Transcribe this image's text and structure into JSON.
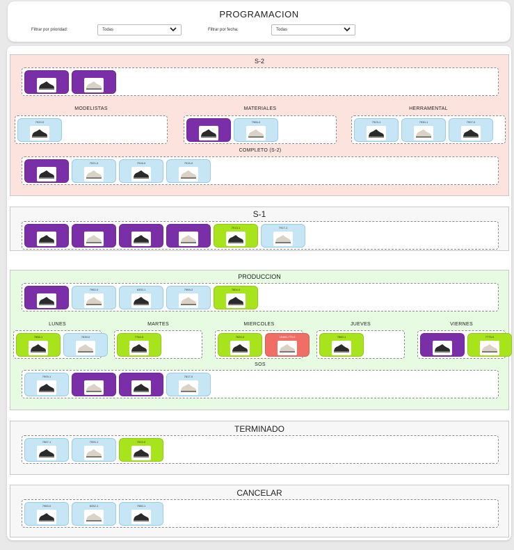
{
  "header": {
    "title": "PROGRAMACION",
    "priority_label": "Filtrar por prioridad:",
    "priority_value": "Todas",
    "date_label": "Filtrar por fecha:",
    "date_value": "Todas"
  },
  "icons": {
    "dropdown": "chevron-down-icon",
    "thumbnail": "shoe-thumbnail-icon"
  },
  "colors": {
    "purple": "#7a2fa8",
    "light_blue": "#c6e6f6",
    "lime": "#a8e41b",
    "red": "#f06e63",
    "s2_bg": "#fde3de",
    "produccion_bg": "#e6fbe2",
    "neutral_bg": "#f7f7f7"
  },
  "sections": {
    "s2": {
      "title": "S-2",
      "top_cards": [
        {
          "code": "",
          "color": "purple"
        },
        {
          "code": "",
          "color": "purple"
        }
      ],
      "modelistas": {
        "title": "MODELISTAS",
        "cards": [
          {
            "code": "7920-0",
            "color": "blue"
          }
        ]
      },
      "materiales": {
        "title": "MATERIALES",
        "cards": [
          {
            "code": "",
            "color": "purple"
          },
          {
            "code": "7966-0",
            "color": "blue"
          }
        ]
      },
      "herramental": {
        "title": "HERRAMENTAL",
        "cards": [
          {
            "code": "7923-1",
            "color": "blue"
          },
          {
            "code": "7930-1",
            "color": "blue"
          },
          {
            "code": "7907-0",
            "color": "blue"
          }
        ]
      },
      "completo": {
        "title": "COMPLETO (S-2)",
        "cards": [
          {
            "code": "",
            "color": "purple"
          },
          {
            "code": "7921-0",
            "color": "blue"
          },
          {
            "code": "7916-0",
            "color": "blue"
          },
          {
            "code": "7915-0",
            "color": "blue"
          }
        ]
      }
    },
    "s1": {
      "title": "S-1",
      "cards": [
        {
          "code": "",
          "color": "purple"
        },
        {
          "code": "",
          "color": "purple"
        },
        {
          "code": "",
          "color": "purple"
        },
        {
          "code": "",
          "color": "purple"
        },
        {
          "code": "7913-1",
          "color": "lime"
        },
        {
          "code": "7917-1",
          "color": "blue"
        }
      ]
    },
    "produccion": {
      "title": "PRODUCCION",
      "top_cards": [
        {
          "code": "",
          "color": "purple"
        },
        {
          "code": "7962-0",
          "color": "blue"
        },
        {
          "code": "6332-1",
          "color": "blue"
        },
        {
          "code": "7969-2",
          "color": "blue"
        },
        {
          "code": "7804-0",
          "color": "lime"
        }
      ],
      "lunes": {
        "title": "LUNES",
        "cards": [
          {
            "code": "7856-1",
            "color": "lime"
          },
          {
            "code": "7639-0",
            "color": "blue"
          }
        ]
      },
      "martes": {
        "title": "MARTES",
        "cards": [
          {
            "code": "7764-0",
            "color": "lime"
          }
        ]
      },
      "miercoles": {
        "title": "MIERCOLES",
        "cards": [
          {
            "code": "7620-0",
            "color": "lime"
          },
          {
            "code": "10460-773-0",
            "color": "red"
          }
        ]
      },
      "jueves": {
        "title": "JUEVES",
        "cards": [
          {
            "code": "7860-1",
            "color": "lime"
          }
        ]
      },
      "viernes": {
        "title": "VIERNES",
        "cards": [
          {
            "code": "",
            "color": "purple"
          },
          {
            "code": "7775-0",
            "color": "lime"
          }
        ]
      },
      "sos": {
        "title": "SOS",
        "cards": [
          {
            "code": "7909-1",
            "color": "blue"
          },
          {
            "code": "",
            "color": "purple"
          },
          {
            "code": "",
            "color": "purple"
          },
          {
            "code": "7817-0",
            "color": "blue"
          }
        ]
      }
    },
    "terminado": {
      "title": "TERMINADO",
      "cards": [
        {
          "code": "7567-1",
          "color": "blue"
        },
        {
          "code": "7590-1",
          "color": "blue"
        },
        {
          "code": "7622-0",
          "color": "lime"
        }
      ]
    },
    "cancelar": {
      "title": "CANCELAR",
      "cards": [
        {
          "code": "7983-0",
          "color": "blue"
        },
        {
          "code": "6332-1",
          "color": "blue"
        },
        {
          "code": "7580-1",
          "color": "blue"
        }
      ]
    }
  }
}
